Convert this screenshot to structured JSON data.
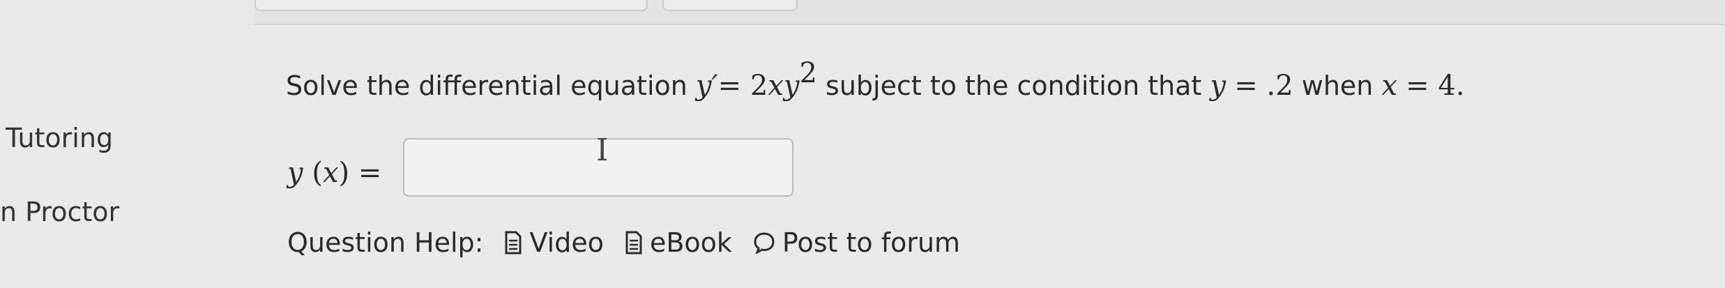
{
  "sidebar": {
    "items": [
      {
        "label": "Tutoring"
      },
      {
        "label": "n Proctor"
      }
    ]
  },
  "question": {
    "prefix": "Solve the differential equation",
    "eq_lhs": "y′",
    "eq_mid": "= 2",
    "eq_x": "xy",
    "eq_exp": "2",
    "middle": "subject to the condition that",
    "cond_y": "y",
    "cond_y_val": "= .2",
    "when": "when",
    "cond_x": "x",
    "cond_x_val": "= 4."
  },
  "answer": {
    "label_y": "y",
    "label_rest": " (",
    "label_x": "x",
    "label_end": ") =",
    "value": ""
  },
  "help": {
    "label": "Question Help:",
    "video": "Video",
    "ebook": "eBook",
    "forum": "Post to forum"
  },
  "icons": {
    "video": "document-icon",
    "ebook": "document-icon",
    "forum": "speech-bubble-icon",
    "cursor": "text-cursor-icon"
  }
}
